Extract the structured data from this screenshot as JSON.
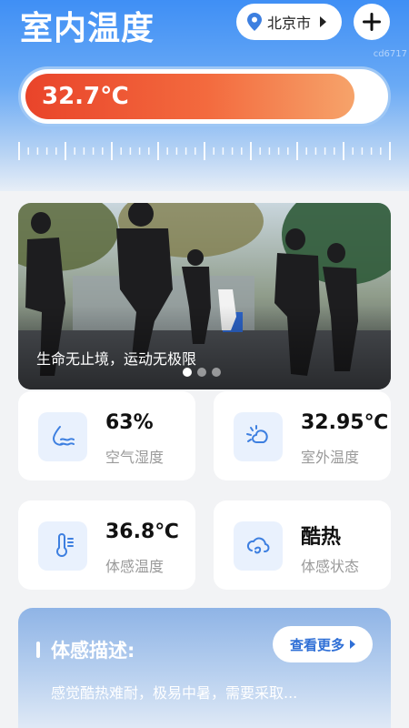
{
  "header": {
    "title": "室内温度",
    "city": "北京市",
    "watermark": "cd6717"
  },
  "thermometer": {
    "value_text": "32.7℃",
    "fill_fraction": 0.92
  },
  "banner": {
    "caption": "生命无止境，运动无极限",
    "slide_count": 3,
    "active_slide": 0
  },
  "stats": [
    {
      "value": "63%",
      "label": "空气湿度",
      "icon": "humidity-icon"
    },
    {
      "value": "32.95℃",
      "label": "室外温度",
      "icon": "weather-sun-cloud-icon"
    },
    {
      "value": "36.8℃",
      "label": "体感温度",
      "icon": "thermometer-icon"
    },
    {
      "value": "酷热",
      "label": "体感状态",
      "icon": "cloud-wind-icon"
    }
  ],
  "description": {
    "heading": "体感描述:",
    "more_label": "查看更多",
    "text": "感觉酷热难耐，极易中暑，需要采取..."
  },
  "colors": {
    "accent_blue": "#3f8ff5",
    "thermo_red": "#e9442a",
    "icon_blue": "#3d7fe0"
  }
}
